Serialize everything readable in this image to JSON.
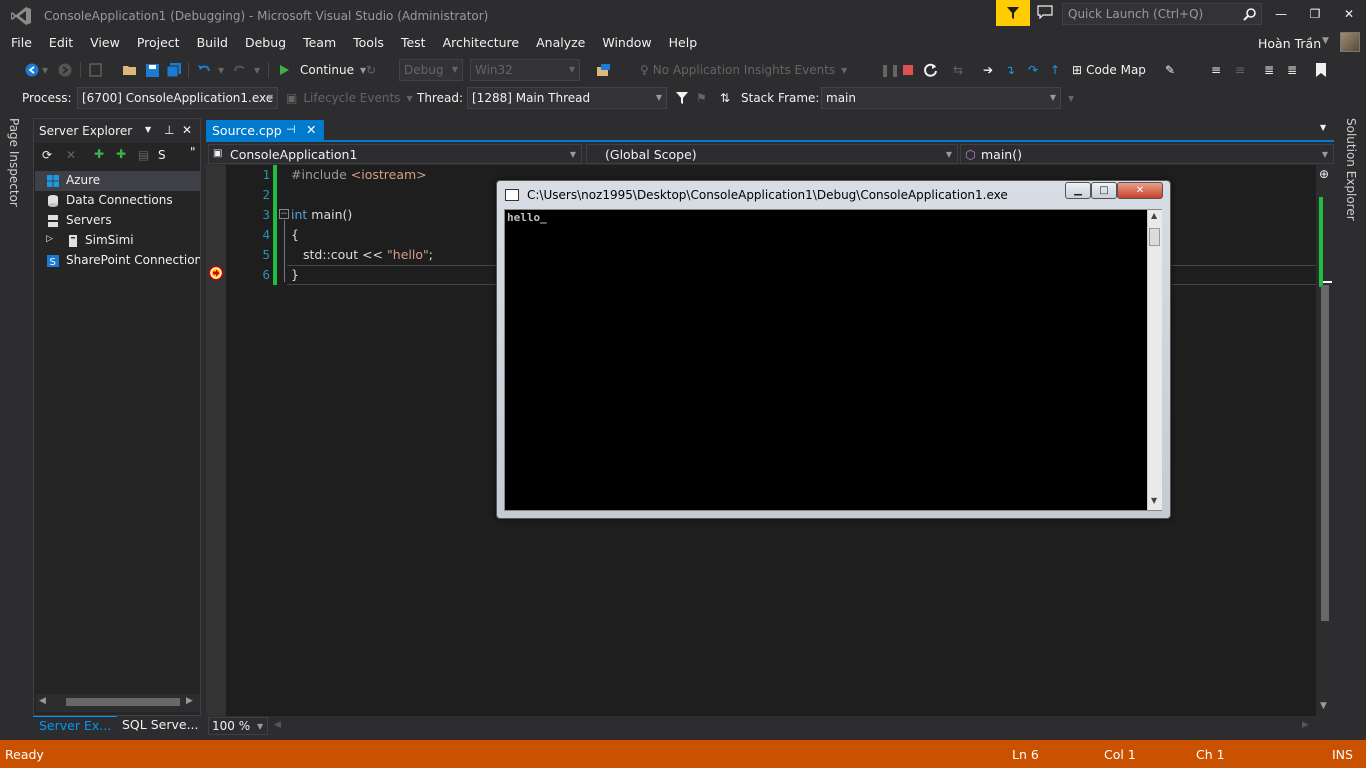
{
  "window": {
    "title": "ConsoleApplication1 (Debugging) - Microsoft Visual Studio (Administrator)",
    "quick_launch_placeholder": "Quick Launch (Ctrl+Q)",
    "min_label": "—",
    "restore_label": "❐",
    "close_label": "✕"
  },
  "menu": [
    "File",
    "Edit",
    "View",
    "Project",
    "Build",
    "Debug",
    "Team",
    "Tools",
    "Test",
    "Architecture",
    "Analyze",
    "Window",
    "Help"
  ],
  "user": {
    "name": "Hoàn Trần"
  },
  "toolbar1": {
    "continue_label": "Continue",
    "config": "Debug",
    "platform": "Win32",
    "insights_label": "No Application Insights Events",
    "code_map_label": "Code Map"
  },
  "toolbar2": {
    "process_label": "Process:",
    "process_value": "[6700] ConsoleApplication1.exe",
    "lifecycle_label": "Lifecycle Events",
    "thread_label": "Thread:",
    "thread_value": "[1288] Main Thread",
    "stack_label": "Stack Frame:",
    "stack_value": "main"
  },
  "left_vtab": "Page Inspector",
  "right_vtab": "Solution Explorer",
  "server_explorer": {
    "title": "Server Explorer",
    "items": [
      {
        "label": "Azure"
      },
      {
        "label": "Data Connections"
      },
      {
        "label": "Servers"
      },
      {
        "label": "SimSimi"
      },
      {
        "label": "SharePoint Connections"
      }
    ],
    "bottom_tabs": [
      "Server Ex...",
      "SQL Serve..."
    ]
  },
  "editor": {
    "tab_label": "Source.cpp",
    "nav_project": "ConsoleApplication1",
    "nav_scope": "(Global Scope)",
    "nav_member": "main()",
    "line_numbers": [
      "1",
      "2",
      "3",
      "4",
      "5",
      "6"
    ],
    "code": {
      "l1_directive": "#include ",
      "l1_header": "<iostream>",
      "l3_kw": "int",
      "l3_rest": " main()",
      "l4": "{",
      "l5_pre": "std::cout << ",
      "l5_str": "\"hello\"",
      "l5_post": ";",
      "l6": "}"
    },
    "zoom": "100 %"
  },
  "console": {
    "title": "C:\\Users\\noz1995\\Desktop\\ConsoleApplication1\\Debug\\ConsoleApplication1.exe",
    "output": "hello_"
  },
  "status": {
    "ready": "Ready",
    "ln": "Ln 6",
    "col": "Col 1",
    "ch": "Ch 1",
    "ins": "INS"
  },
  "colors": {
    "status_bar": "#ca5100",
    "accent": "#007acc",
    "notification": "#ffcc00",
    "change_bar": "#1fbf3d"
  }
}
